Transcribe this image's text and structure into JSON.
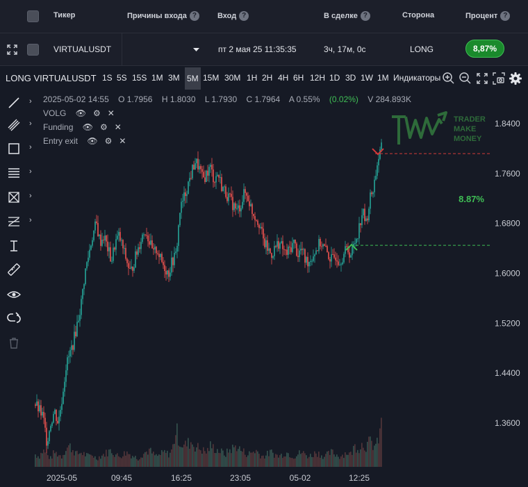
{
  "table": {
    "headers": {
      "ticker": "Тикер",
      "reasons": "Причины входа",
      "entry": "Вход",
      "in_trade": "В сделке",
      "side": "Сторона",
      "percent": "Процент"
    },
    "help_glyph": "?",
    "row": {
      "ticker": "VIRTUALUSDT",
      "entry": "пт 2 мая 25 11:35:35",
      "in_trade": "3ч, 17м, 0с",
      "side": "LONG",
      "percent": "8,87%"
    }
  },
  "chart_toolbar": {
    "title": "LONG VIRTUALUSDT",
    "timeframes": [
      "1S",
      "5S",
      "15S",
      "1M",
      "3M",
      "5M",
      "15M",
      "30M",
      "1H",
      "2H",
      "4H",
      "6H",
      "12H",
      "1D",
      "3D",
      "1W",
      "1M"
    ],
    "active_timeframe": "5M",
    "indicators_label": "Индикаторы"
  },
  "legend": {
    "datetime": "2025-05-02 14:55",
    "open": "O 1.7956",
    "high": "H 1.8030",
    "low": "L 1.7930",
    "close": "C 1.7964",
    "amplitude": "A 0.55%",
    "change": "(0.02%)",
    "volume": "V 284.893K"
  },
  "indicators": [
    "VOLG",
    "Funding",
    "Entry exit"
  ],
  "watermark": {
    "line1": "TRADER",
    "line2": "MAKE",
    "line3": "MONEY"
  },
  "trade_percent_label": "8.87%",
  "colors": {
    "up": "#26a69a",
    "down": "#ef5350",
    "entry_line": "#3fbf55",
    "exit_line": "#d33a3a",
    "badge": "#1a8a2c"
  },
  "chart_data": {
    "type": "candlestick",
    "y_ticks": [
      "1.8400",
      "1.7600",
      "1.6800",
      "1.6000",
      "1.5200",
      "1.4400",
      "1.3600"
    ],
    "x_ticks": [
      "2025-05",
      "09:45",
      "16:25",
      "23:05",
      "05-02",
      "12:25"
    ],
    "ylim": [
      1.32,
      1.86
    ],
    "entry_price": 1.645,
    "exit_price": 1.792,
    "price_path": [
      1.39,
      1.38,
      1.37,
      1.33,
      1.36,
      1.38,
      1.36,
      1.4,
      1.45,
      1.47,
      1.49,
      1.52,
      1.55,
      1.6,
      1.63,
      1.66,
      1.68,
      1.65,
      1.66,
      1.64,
      1.62,
      1.65,
      1.66,
      1.64,
      1.62,
      1.6,
      1.62,
      1.64,
      1.66,
      1.67,
      1.65,
      1.63,
      1.64,
      1.62,
      1.61,
      1.6,
      1.62,
      1.63,
      1.7,
      1.72,
      1.74,
      1.76,
      1.78,
      1.77,
      1.75,
      1.76,
      1.77,
      1.75,
      1.76,
      1.74,
      1.73,
      1.72,
      1.71,
      1.7,
      1.71,
      1.73,
      1.72,
      1.7,
      1.69,
      1.68,
      1.65,
      1.64,
      1.63,
      1.64,
      1.65,
      1.64,
      1.63,
      1.64,
      1.65,
      1.63,
      1.64,
      1.62,
      1.62,
      1.63,
      1.64,
      1.65,
      1.64,
      1.63,
      1.62,
      1.63,
      1.62,
      1.63,
      1.64,
      1.63,
      1.65,
      1.67,
      1.7,
      1.68,
      1.72,
      1.74,
      1.78,
      1.8
    ],
    "volume_path": [
      0.3,
      0.25,
      0.4,
      0.3,
      0.2,
      0.35,
      0.3,
      0.25,
      0.45,
      0.5,
      0.4,
      0.3,
      0.35,
      0.3,
      0.25,
      0.3,
      0.2,
      0.25,
      0.3,
      0.35,
      0.4,
      0.3,
      0.25,
      0.3,
      0.35,
      0.3,
      0.25,
      0.2,
      0.3,
      0.35,
      0.4,
      0.3,
      0.25,
      0.3,
      0.35,
      0.3,
      0.4,
      0.9,
      0.6,
      0.5,
      0.55,
      0.6,
      0.5,
      0.45,
      0.4,
      0.35,
      0.5,
      0.45,
      0.4,
      0.35,
      0.3,
      0.4,
      0.45,
      0.5,
      0.4,
      0.35,
      0.3,
      0.35,
      0.4,
      0.3,
      0.25,
      0.3,
      0.35,
      0.3,
      0.25,
      0.3,
      0.35,
      0.3,
      0.25,
      0.3,
      0.35,
      0.3,
      0.25,
      0.3,
      0.35,
      0.3,
      0.25,
      0.3,
      0.35,
      0.3,
      0.25,
      0.3,
      0.35,
      0.3,
      0.5,
      0.45,
      0.55,
      0.5,
      0.6,
      0.5,
      0.55,
      1.0
    ]
  }
}
